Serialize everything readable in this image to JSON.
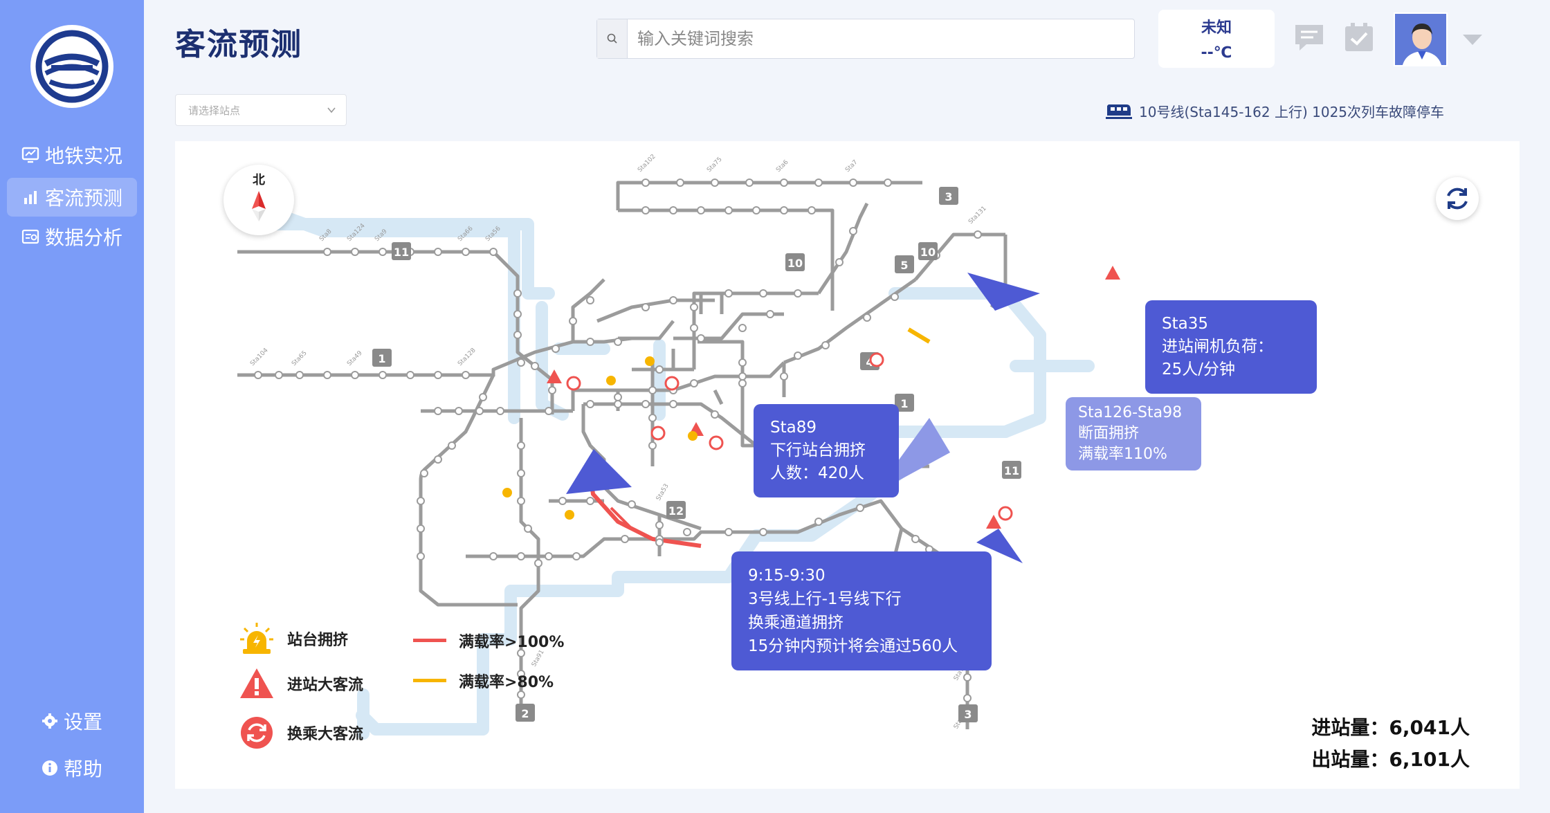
{
  "app": {
    "title": "客流预测"
  },
  "sidebar": {
    "items": [
      {
        "label": "地铁实况",
        "icon": "monitor-icon"
      },
      {
        "label": "客流预测",
        "icon": "bar-chart-icon",
        "active": true
      },
      {
        "label": "数据分析",
        "icon": "analysis-icon"
      }
    ],
    "bottom": [
      {
        "label": "设置",
        "icon": "gear-icon"
      },
      {
        "label": "帮助",
        "icon": "info-icon"
      }
    ]
  },
  "search": {
    "placeholder": "输入关键词搜索",
    "value": ""
  },
  "weather": {
    "condition": "未知",
    "temperature": "--℃"
  },
  "station_select": {
    "placeholder": "请选择站点"
  },
  "alert": {
    "text": "10号线(Sta145-162 上行) 1025次列车故障停车"
  },
  "compass": {
    "label": "北"
  },
  "line_badges": [
    "1",
    "2",
    "3",
    "3",
    "4",
    "5",
    "10",
    "10",
    "11",
    "11",
    "12",
    "1"
  ],
  "bubbles": {
    "sta89": {
      "l1": "Sta89",
      "l2": "下行站台拥挤",
      "l3": "人数：420人"
    },
    "sta35": {
      "l1": "Sta35",
      "l2": "进站闸机负荷：",
      "l3": "25人/分钟"
    },
    "sta126": {
      "l1": "Sta126-Sta98",
      "l2": "断面拥挤",
      "l3": "满载率110%"
    },
    "transfer": {
      "l1": "9:15-9:30",
      "l2": "3号线上行-1号线下行",
      "l3": "换乘通道拥挤",
      "l4": "15分钟内预计将会通过560人"
    }
  },
  "legend": {
    "platform": "站台拥挤",
    "inflow": "进站大客流",
    "transfer": "换乘大客流",
    "load100": "满载率>100%",
    "load80": "满载率>80%"
  },
  "stats": {
    "in": "进站量：6,041人",
    "out": "出站量：6,101人"
  },
  "colors": {
    "sidebar": "#7b9cf8",
    "bubble": "#4e5ad4",
    "bubble_light": "#8d98e6",
    "danger": "#ef5350",
    "warning": "#f7b500",
    "line": "#9e9e9e",
    "river": "#d6e8f5"
  }
}
